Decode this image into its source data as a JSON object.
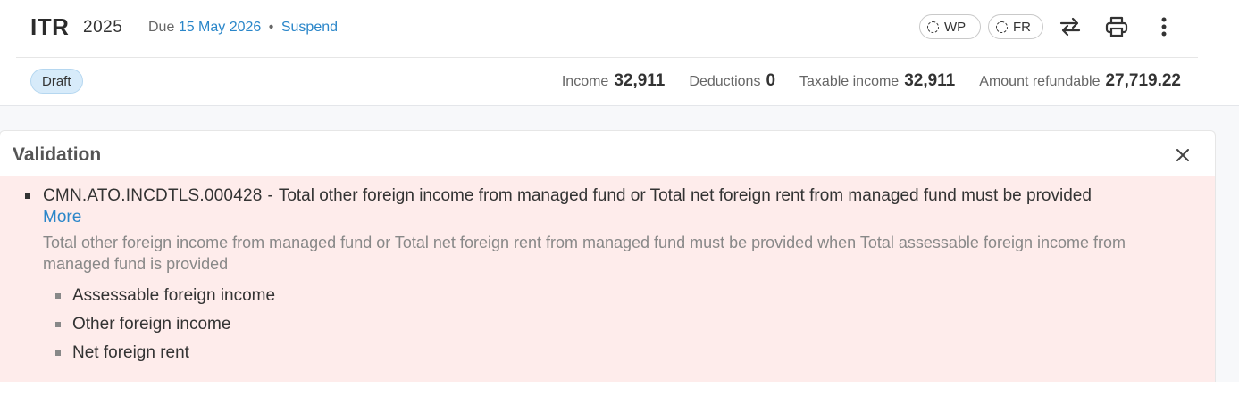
{
  "header": {
    "form_name": "ITR",
    "year": "2025",
    "due_label": "Due",
    "due_date": "15 May 2026",
    "separator": "•",
    "suspend_label": "Suspend",
    "pills": [
      {
        "label": "WP",
        "icon": "dashed-circle-icon"
      },
      {
        "label": "FR",
        "icon": "dashed-circle-icon"
      }
    ],
    "actions": [
      "swap-icon",
      "print-icon",
      "more-vertical-icon"
    ]
  },
  "status": {
    "badge": "Draft",
    "stats": [
      {
        "label": "Income",
        "value": "32,911"
      },
      {
        "label": "Deductions",
        "value": "0"
      },
      {
        "label": "Taxable income",
        "value": "32,911"
      },
      {
        "label": "Amount refundable",
        "value": "27,719.22"
      }
    ]
  },
  "validation": {
    "title": "Validation",
    "close_icon": "close-icon",
    "errors": [
      {
        "code": "CMN.ATO.INCDTLS.000428",
        "dash": "-",
        "message": "Total other foreign income from managed fund or Total net foreign rent from managed fund must be provided",
        "more_label": "More",
        "description": "Total other foreign income from managed fund or Total net foreign rent from managed fund must be provided when Total assessable foreign income from managed fund is provided",
        "fields": [
          "Assessable foreign income",
          "Other foreign income",
          "Net foreign rent"
        ]
      }
    ]
  },
  "colors": {
    "link": "#2a86c9",
    "error_bg": "#feeceb",
    "badge_bg": "#d7ebfa"
  }
}
